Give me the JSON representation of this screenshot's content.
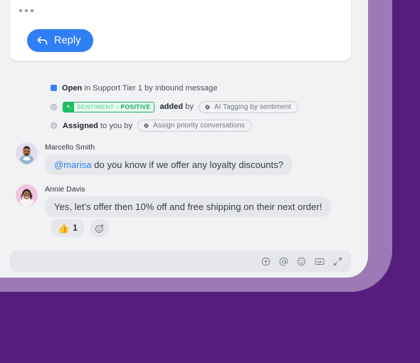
{
  "theme": {
    "background_purple": "#561D7E",
    "mauve_layer": "#9B7AB5",
    "panel_gray": "#F1F2F4",
    "card_white": "#FFFFFF",
    "accent_blue": "#2F7EF4",
    "bubble_gray": "#E5E7EB",
    "sentiment_green": "#1DBF63",
    "status_blue": "#3B82F6"
  },
  "reply_card": {
    "typing_indicator": "...",
    "reply_label": "Reply",
    "reply_icon": "reply-arrow-icon"
  },
  "events": [
    {
      "icon": "status-square-icon",
      "bold": "Open",
      "rest": " in Support Tier 1 by inbound message"
    },
    {
      "icon": "gear-outline-icon",
      "badge": {
        "sparkle_icon": "sparkle-icon",
        "key": "SENTIMENT",
        "separator": "›",
        "value": "POSITIVE"
      },
      "bold": "added",
      "rest": " by",
      "pill": {
        "icon": "gear-solid-icon",
        "label": "AI Tagging by sentiment"
      }
    },
    {
      "icon": "gear-outline-icon",
      "bold": "Assigned",
      "rest": " to you by",
      "pill": {
        "icon": "gear-solid-icon",
        "label": "Assign priority conversations"
      }
    }
  ],
  "messages": [
    {
      "author": "Marcello Smith",
      "avatar": "avatar-marcello-smith",
      "mention": "@marisa",
      "text": " do you know if we offer any loyalty discounts?"
    },
    {
      "author": "Annie Davis",
      "avatar": "avatar-annie-davis",
      "text": "Yes, let's offer then 10% off and free shipping on their next order!"
    }
  ],
  "reactions": {
    "thumbs_up": {
      "emoji": "👍",
      "count": "1"
    },
    "add_reaction_icon": "add-reaction-icon"
  },
  "composer": {
    "placeholder": "",
    "value": "",
    "tools": [
      {
        "icon": "plus-circle-icon",
        "name": "attach"
      },
      {
        "icon": "at-sign-icon",
        "name": "mention"
      },
      {
        "icon": "emoji-smiley-icon",
        "name": "emoji"
      },
      {
        "icon": "gif-icon",
        "name": "gif"
      },
      {
        "icon": "expand-icon",
        "name": "expand"
      }
    ]
  }
}
